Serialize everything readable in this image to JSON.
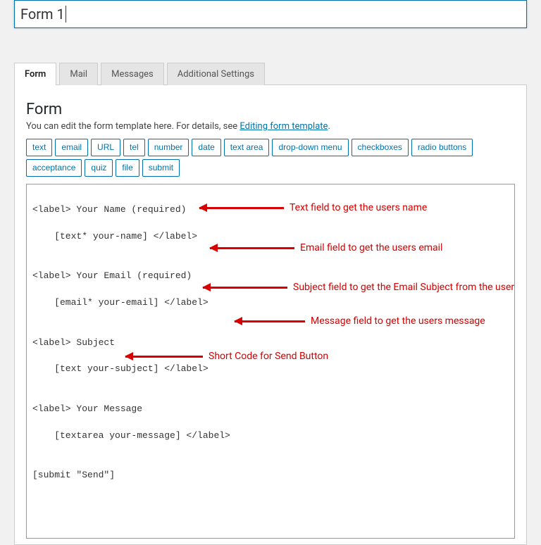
{
  "form_title": "Form 1",
  "tabs": {
    "form": "Form",
    "mail": "Mail",
    "messages": "Messages",
    "additional": "Additional Settings"
  },
  "panel": {
    "heading": "Form",
    "help_prefix": "You can edit the form template here. For details, see ",
    "help_link": "Editing form template",
    "help_suffix": "."
  },
  "tag_buttons": {
    "text": "text",
    "email": "email",
    "url": "URL",
    "tel": "tel",
    "number": "number",
    "date": "date",
    "textarea": "text area",
    "dropdown": "drop-down menu",
    "checkboxes": "checkboxes",
    "radio": "radio buttons",
    "acceptance": "acceptance",
    "quiz": "quiz",
    "file": "file",
    "submit": "submit"
  },
  "code": {
    "l1": "<label> Your Name (required)",
    "l2": "    [text* your-name] </label>",
    "l3": "<label> Your Email (required)",
    "l4": "    [email* your-email] </label>",
    "l5": "<label> Subject",
    "l6": "    [text your-subject] </label>",
    "l7": "<label> Your Message",
    "l8": "    [textarea your-message] </label>",
    "l9": "[submit \"Send\"]"
  },
  "annotations": {
    "a1": "Text field to get the users name",
    "a2": "Email field to get the users email",
    "a3": "Subject field to get the Email Subject from the user",
    "a4": "Message field to get the users message",
    "a5": "Short Code for Send Button"
  }
}
